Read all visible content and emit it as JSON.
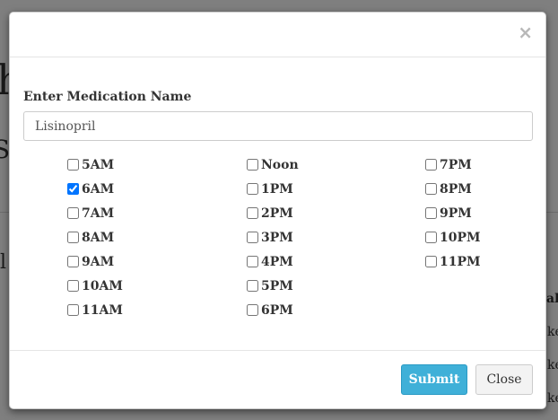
{
  "modal": {
    "close_glyph": "×",
    "field_label": "Enter Medication Name",
    "medication_value": "Lisinopril",
    "time_columns": [
      [
        {
          "label": "5AM",
          "checked": false
        },
        {
          "label": "6AM",
          "checked": true
        },
        {
          "label": "7AM",
          "checked": false
        },
        {
          "label": "8AM",
          "checked": false
        },
        {
          "label": "9AM",
          "checked": false
        },
        {
          "label": "10AM",
          "checked": false
        },
        {
          "label": "11AM",
          "checked": false
        }
      ],
      [
        {
          "label": "Noon",
          "checked": false
        },
        {
          "label": "1PM",
          "checked": false
        },
        {
          "label": "2PM",
          "checked": false
        },
        {
          "label": "3PM",
          "checked": false
        },
        {
          "label": "4PM",
          "checked": false
        },
        {
          "label": "5PM",
          "checked": false
        },
        {
          "label": "6PM",
          "checked": false
        }
      ],
      [
        {
          "label": "7PM",
          "checked": false
        },
        {
          "label": "8PM",
          "checked": false
        },
        {
          "label": "9PM",
          "checked": false
        },
        {
          "label": "10PM",
          "checked": false
        },
        {
          "label": "11PM",
          "checked": false
        }
      ]
    ],
    "submit_label": "Submit",
    "close_label": "Close"
  },
  "colors": {
    "submit_bg": "#3fb0d8",
    "backdrop": "rgba(0,0,0,0.5)"
  }
}
